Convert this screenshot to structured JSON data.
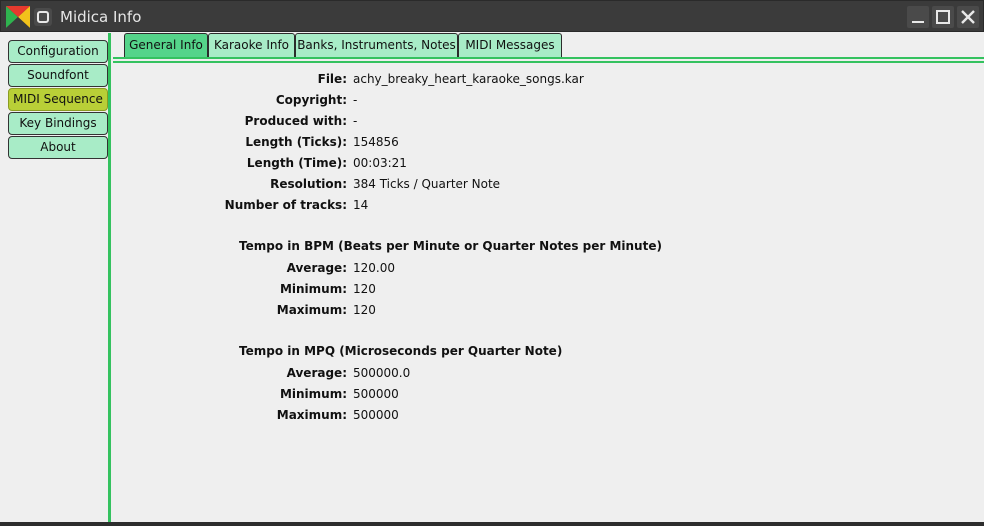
{
  "window": {
    "title": "Midica Info"
  },
  "sidebar": {
    "items": [
      {
        "label": "Configuration"
      },
      {
        "label": "Soundfont"
      },
      {
        "label": "MIDI Sequence",
        "active": true
      },
      {
        "label": "Key Bindings"
      },
      {
        "label": "About"
      }
    ]
  },
  "tabs": [
    {
      "label": "General Info",
      "active": true
    },
    {
      "label": "Karaoke Info"
    },
    {
      "label": "Banks, Instruments, Notes"
    },
    {
      "label": "MIDI Messages"
    }
  ],
  "general": {
    "file_label": "File:",
    "file_value": "achy_breaky_heart_karaoke_songs.kar",
    "copyright_label": "Copyright:",
    "copyright_value": "-",
    "produced_label": "Produced with:",
    "produced_value": "-",
    "length_ticks_label": "Length (Ticks):",
    "length_ticks_value": "154856",
    "length_time_label": "Length (Time):",
    "length_time_value": "00:03:21",
    "resolution_label": "Resolution:",
    "resolution_value": "384 Ticks / Quarter Note",
    "tracks_label": "Number of tracks:",
    "tracks_value": "14"
  },
  "tempo_bpm": {
    "heading": "Tempo in BPM (Beats per Minute or Quarter Notes per Minute)",
    "average_label": "Average:",
    "average_value": "120.00",
    "minimum_label": "Minimum:",
    "minimum_value": "120",
    "maximum_label": "Maximum:",
    "maximum_value": "120"
  },
  "tempo_mpq": {
    "heading": "Tempo in MPQ (Microseconds per Quarter Note)",
    "average_label": "Average:",
    "average_value": "500000.0",
    "minimum_label": "Minimum:",
    "minimum_value": "500000",
    "maximum_label": "Maximum:",
    "maximum_value": "500000"
  },
  "colors": {
    "accent_green": "#34c25f",
    "button_green": "#a8ecc7",
    "active_tab": "#55d48a",
    "active_nav": "#b9cf37",
    "titlebar": "#3b3b3b"
  },
  "icons": {
    "app_logo": "midica-logo-icon",
    "system_menu": "system-menu-icon",
    "minimize": "minimize-icon",
    "maximize": "maximize-icon",
    "close": "close-icon"
  }
}
